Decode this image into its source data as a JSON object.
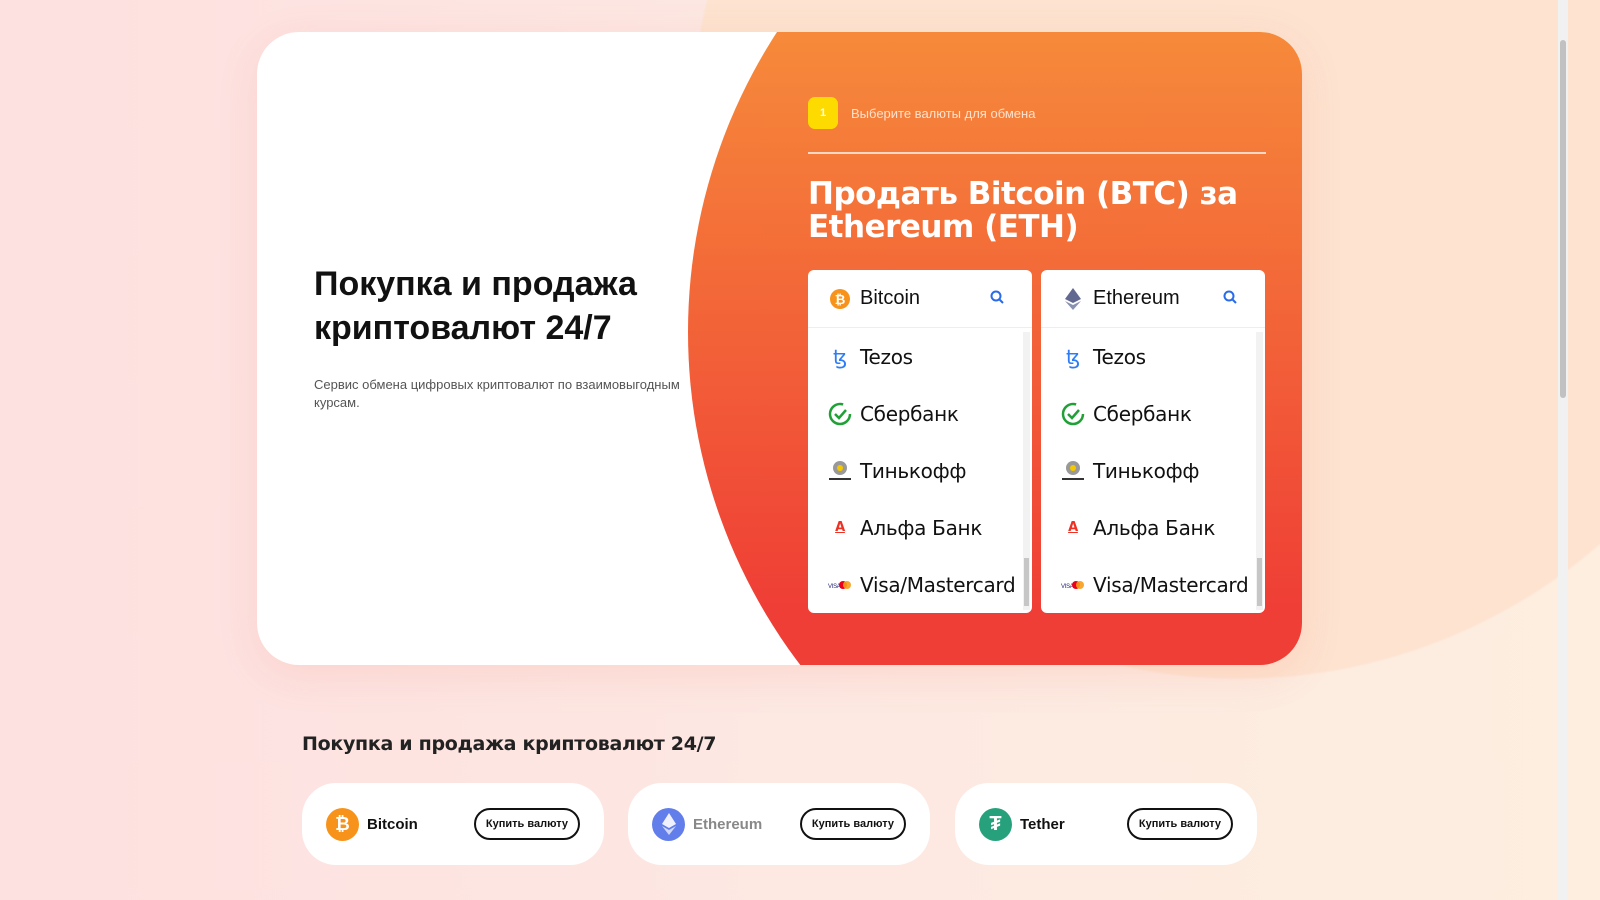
{
  "hero": {
    "title": "Покупка и продажа криптовалют 24/7",
    "subtitle": "Сервис обмена цифровых криптовалют по взаимовыгодным курсам."
  },
  "exchange": {
    "step_number": "1",
    "step_text": "Выберите валюты для обмена",
    "title": "Продать Bitcoin (BTC) за Ethereum (ETH)",
    "from": {
      "selected": "Bitcoin",
      "items": [
        "Tezos",
        "Сбербанк",
        "Тинькофф",
        "Альфа Банк",
        "Visa/Mastercard"
      ]
    },
    "to": {
      "selected": "Ethereum",
      "items": [
        "Tezos",
        "Сбербанк",
        "Тинькофф",
        "Альфа Банк",
        "Visa/Mastercard"
      ]
    }
  },
  "section": {
    "title": "Покупка и продажа криптовалют 24/7",
    "coins": [
      {
        "name": "Bitcoin",
        "button": "Купить валюту",
        "color": "#f7931a"
      },
      {
        "name": "Ethereum",
        "button": "Купить валюту",
        "color": "#627eea"
      },
      {
        "name": "Tether",
        "button": "Купить валюту",
        "color": "#26a17b"
      }
    ]
  }
}
